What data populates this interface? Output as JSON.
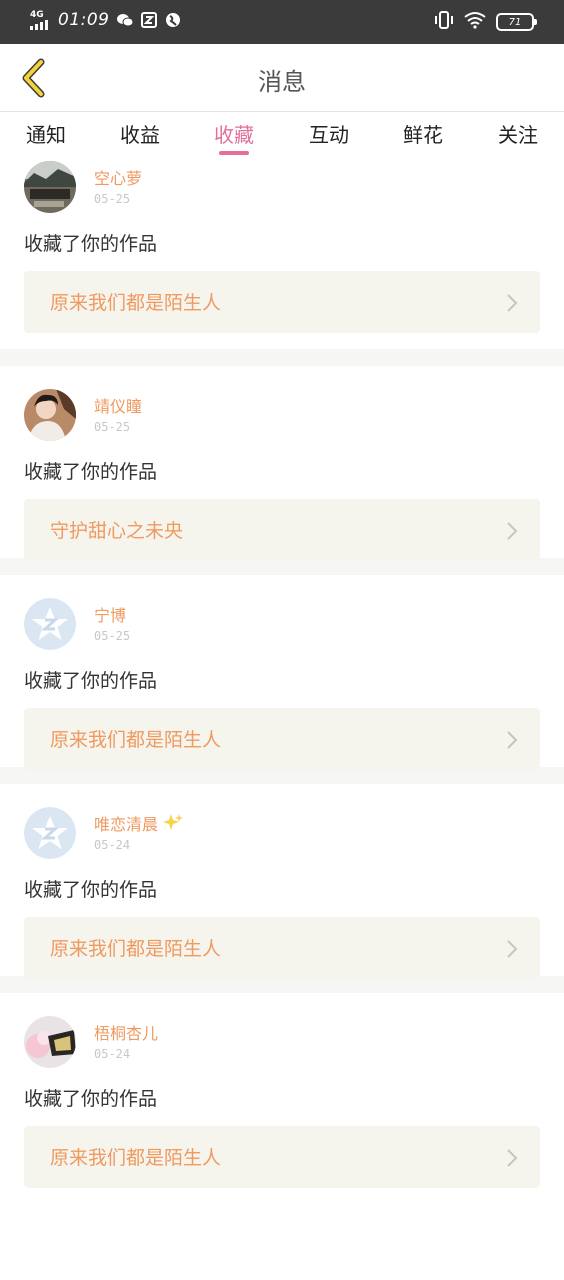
{
  "status_bar": {
    "network": "4G",
    "time": "01:09",
    "battery": "71",
    "icons": [
      "signal-icon",
      "wechat-icon",
      "app-icon",
      "browser-icon",
      "vibrate-icon",
      "wifi-icon",
      "battery-icon"
    ]
  },
  "header": {
    "title": "消息",
    "back_icon": "back-chevron-icon"
  },
  "tabs": [
    {
      "label": "通知"
    },
    {
      "label": "收益"
    },
    {
      "label": "收藏",
      "active": true
    },
    {
      "label": "互动"
    },
    {
      "label": "鲜花"
    },
    {
      "label": "关注"
    }
  ],
  "colors": {
    "accent_pink": "#e26f9c",
    "name_orange": "#f09a60",
    "card_bg": "#f5f5ee",
    "status_bar": "#3b3b3b",
    "back_chevron": "#f3d23a"
  },
  "feed": [
    {
      "name": "空心萝",
      "date": "05-25",
      "action": "收藏了你的作品",
      "work": "原来我们都是陌生人",
      "avatar": "photo-avatar"
    },
    {
      "name": "靖仪瞳",
      "date": "05-25",
      "action": "收藏了你的作品",
      "work": "守护甜心之未央",
      "avatar": "portrait-avatar"
    },
    {
      "name": "宁博",
      "date": "05-25",
      "action": "收藏了你的作品",
      "work": "原来我们都是陌生人",
      "avatar": "default-avatar"
    },
    {
      "name": "唯恋清晨",
      "date": "05-24",
      "action": "收藏了你的作品",
      "work": "原来我们都是陌生人",
      "avatar": "default-avatar",
      "badge": "sparkles-icon"
    },
    {
      "name": "梧桐杏儿",
      "date": "05-24",
      "action": "收藏了你的作品",
      "work": "原来我们都是陌生人",
      "avatar": "illustration-avatar"
    }
  ]
}
